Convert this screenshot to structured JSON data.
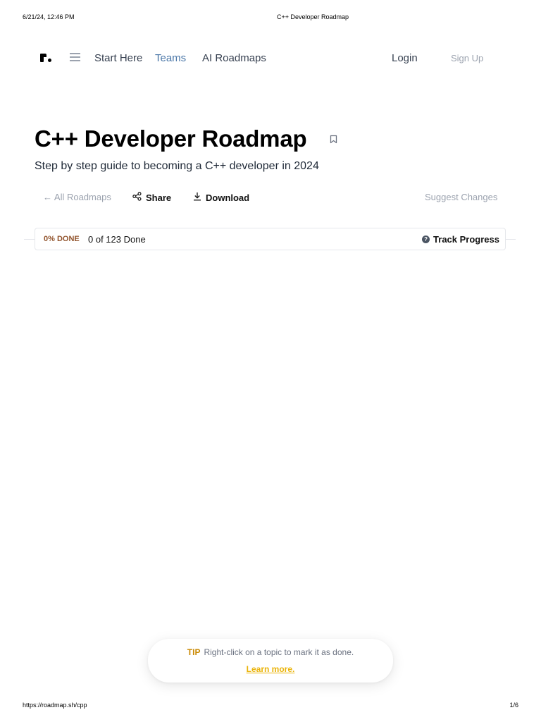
{
  "print": {
    "date": "6/21/24, 12:46 PM",
    "title": "C++ Developer Roadmap",
    "url": "https://roadmap.sh/cpp",
    "page": "1/6"
  },
  "nav": {
    "logo_icon": "roadmap-logo",
    "menu_icon": "hamburger-icon",
    "start_here": "Start Here",
    "teams": "Teams",
    "ai_roadmaps": "AI Roadmaps",
    "login": "Login",
    "signup": "Sign Up"
  },
  "header": {
    "title": "C++ Developer Roadmap",
    "bookmark_icon": "bookmark-icon",
    "subtitle": "Step by step guide to becoming a C++ developer in 2024"
  },
  "actions": {
    "all_roadmaps": "← All Roadmaps",
    "share": "Share",
    "share_icon": "share-icon",
    "download": "Download",
    "download_icon": "download-icon",
    "suggest": "Suggest Changes"
  },
  "progress": {
    "percent_label": "0% DONE",
    "done_text": "0 of 123 Done",
    "track_label": "Track Progress",
    "track_icon": "question-icon"
  },
  "tip": {
    "label": "TIP",
    "text": "Right-click on a topic to mark it as done.",
    "link": "Learn more."
  },
  "colors": {
    "teams_link": "#4b77a8",
    "percent": "#92542d",
    "tip_accent": "#eab308"
  }
}
